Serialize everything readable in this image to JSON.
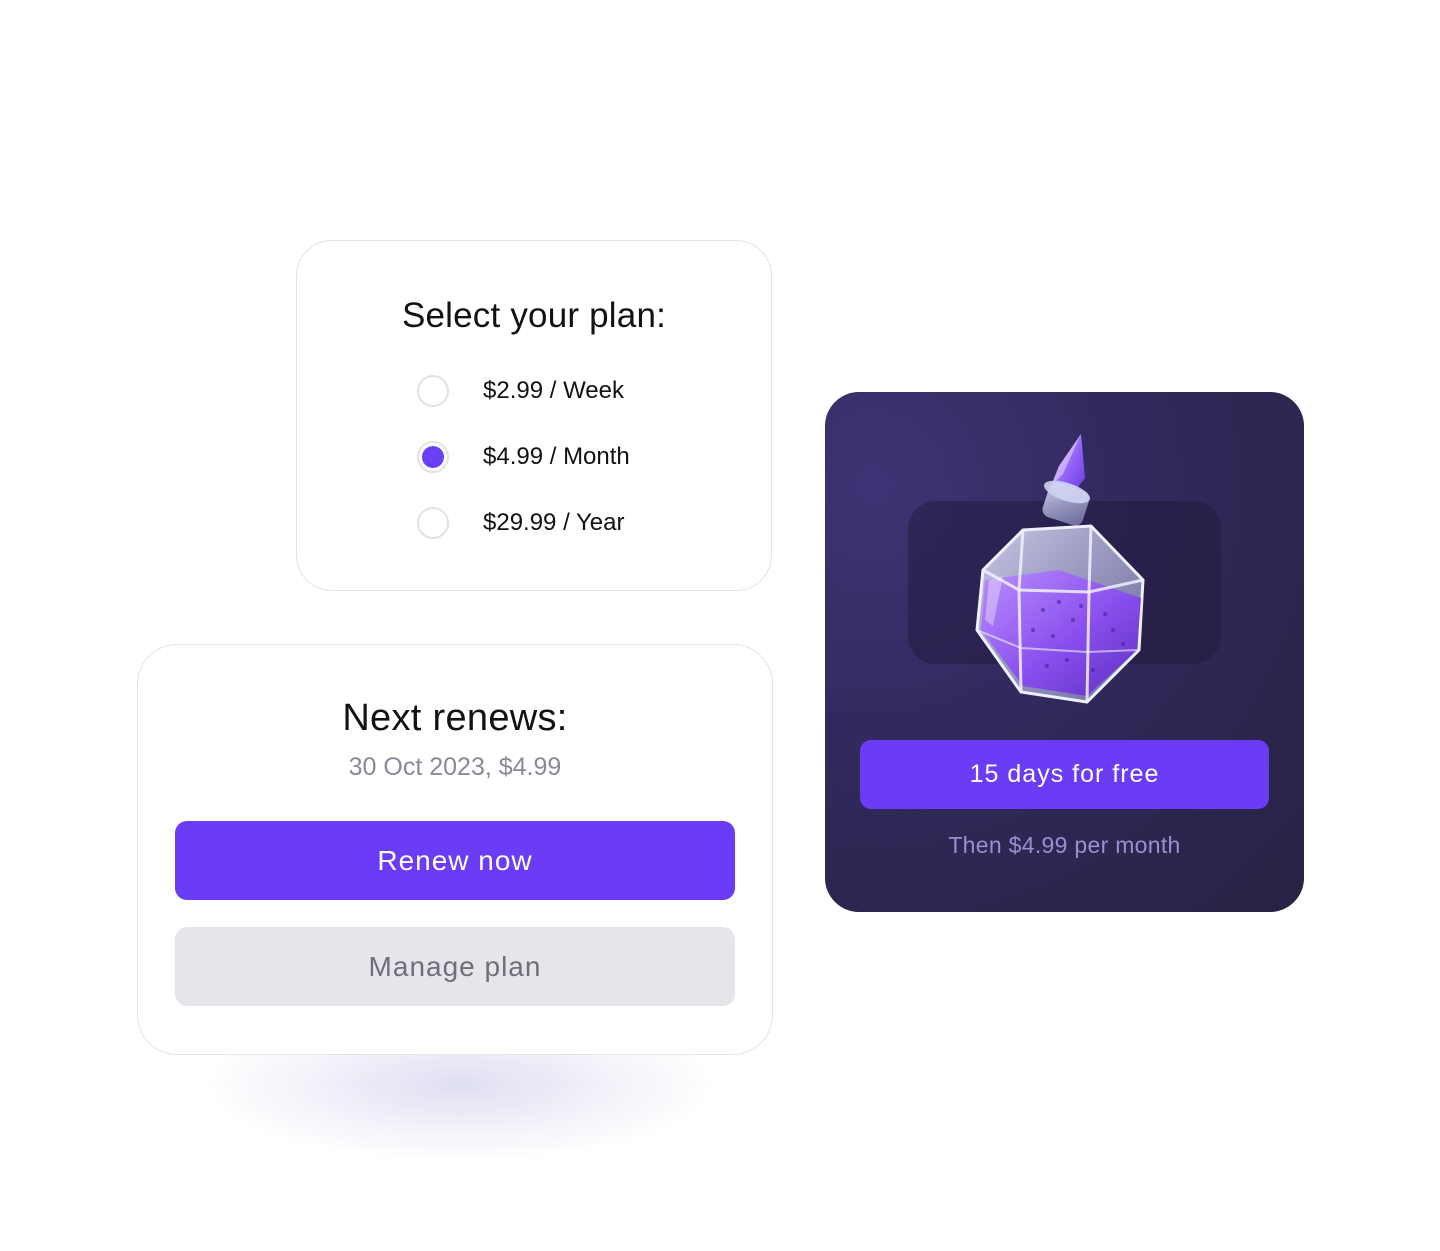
{
  "plan_selector": {
    "title": "Select your plan:",
    "selected_index": 1,
    "options": [
      {
        "label": "$2.99 / Week",
        "selected": false
      },
      {
        "label": "$4.99 / Month",
        "selected": true
      },
      {
        "label": "$29.99 / Year",
        "selected": false
      }
    ]
  },
  "renewal": {
    "title": "Next renews:",
    "date_line": "30 Oct 2023, $4.99",
    "renew_button": "Renew now",
    "manage_button": "Manage plan"
  },
  "promo": {
    "image_icon": "potion-bottle-icon",
    "trial_button": "15 days for free",
    "price_note": "Then $4.99 per month"
  },
  "colors": {
    "accent": "#6a3cf6",
    "secondary_button": "#e5e6e9",
    "promo_background": "#2e2856",
    "muted_text": "#8a8a96"
  }
}
